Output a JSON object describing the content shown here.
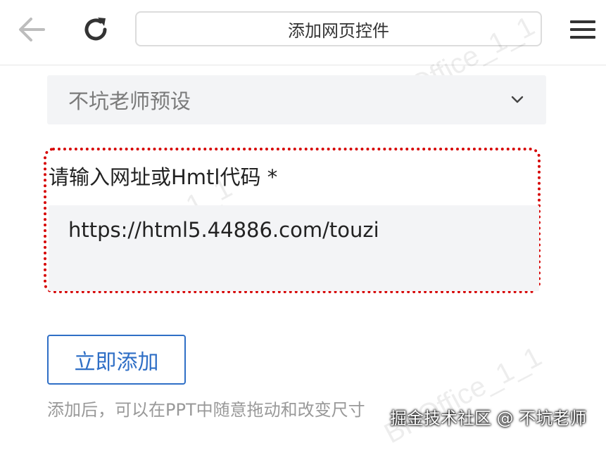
{
  "header": {
    "title": "添加网页控件",
    "icons": {
      "back": "back-arrow-icon",
      "reload": "reload-icon",
      "menu": "hamburger-menu-icon"
    }
  },
  "watermarks": [
    "BKOffice_1_1",
    "BKOffice_1_1",
    "BKOffice_1_1"
  ],
  "preset": {
    "selected": "不坑老师预设"
  },
  "form": {
    "url_label": "请输入网址或Hmtl代码 *",
    "url_value": "https://html5.44886.com/touzi"
  },
  "actions": {
    "add_label": "立即添加"
  },
  "hint": "添加后，可以在PPT中随意拖动和改变尺寸",
  "credit": "掘金技术社区 @ 不坑老师",
  "colors": {
    "accent": "#2f6fc6",
    "highlight": "#d60000",
    "field_bg": "#f3f4f6"
  }
}
